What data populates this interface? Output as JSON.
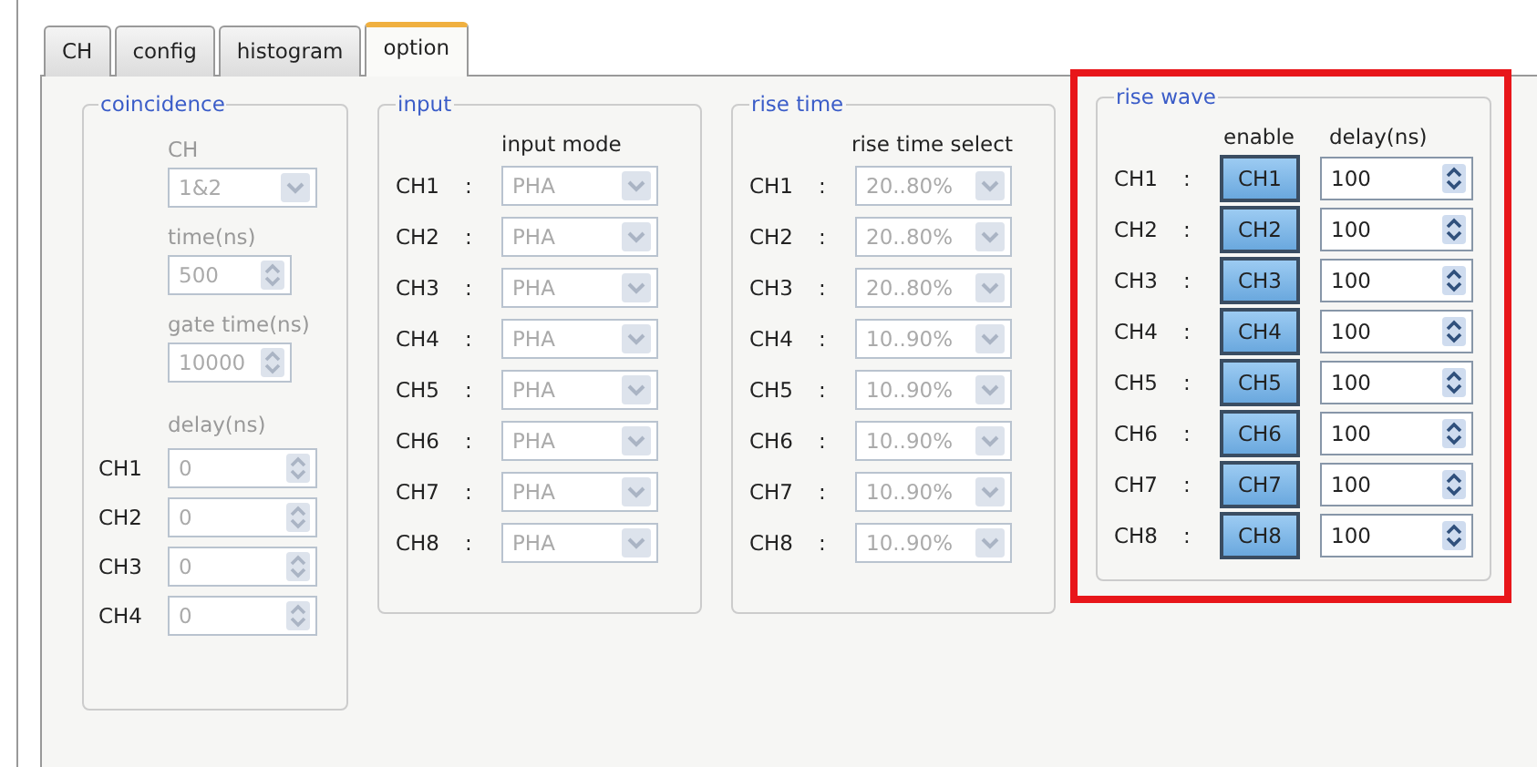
{
  "tabs": [
    {
      "label": "CH",
      "selected": false
    },
    {
      "label": "config",
      "selected": false
    },
    {
      "label": "histogram",
      "selected": false
    },
    {
      "label": "option",
      "selected": true
    }
  ],
  "coincidence": {
    "title": "coincidence",
    "disabled": true,
    "ch_label": "CH",
    "ch_value": "1&2",
    "time_label": "time(ns)",
    "time_value": "500",
    "gate_label": "gate time(ns)",
    "gate_value": "10000",
    "delay_label": "delay(ns)",
    "delays": [
      {
        "channel": "CH1",
        "value": "0"
      },
      {
        "channel": "CH2",
        "value": "0"
      },
      {
        "channel": "CH3",
        "value": "0"
      },
      {
        "channel": "CH4",
        "value": "0"
      }
    ]
  },
  "input": {
    "title": "input",
    "disabled": true,
    "column_header": "input mode",
    "rows": [
      {
        "channel": "CH1",
        "separator": ":",
        "value": "PHA"
      },
      {
        "channel": "CH2",
        "separator": ":",
        "value": "PHA"
      },
      {
        "channel": "CH3",
        "separator": ":",
        "value": "PHA"
      },
      {
        "channel": "CH4",
        "separator": ":",
        "value": "PHA"
      },
      {
        "channel": "CH5",
        "separator": ":",
        "value": "PHA"
      },
      {
        "channel": "CH6",
        "separator": ":",
        "value": "PHA"
      },
      {
        "channel": "CH7",
        "separator": ":",
        "value": "PHA"
      },
      {
        "channel": "CH8",
        "separator": ":",
        "value": "PHA"
      }
    ]
  },
  "rise_time": {
    "title": "rise time",
    "disabled": true,
    "column_header": "rise time select",
    "rows": [
      {
        "channel": "CH1",
        "separator": ":",
        "value": "20..80%"
      },
      {
        "channel": "CH2",
        "separator": ":",
        "value": "20..80%"
      },
      {
        "channel": "CH3",
        "separator": ":",
        "value": "20..80%"
      },
      {
        "channel": "CH4",
        "separator": ":",
        "value": "10..90%"
      },
      {
        "channel": "CH5",
        "separator": ":",
        "value": "10..90%"
      },
      {
        "channel": "CH6",
        "separator": ":",
        "value": "10..90%"
      },
      {
        "channel": "CH7",
        "separator": ":",
        "value": "10..90%"
      },
      {
        "channel": "CH8",
        "separator": ":",
        "value": "10..90%"
      }
    ]
  },
  "rise_wave": {
    "title": "rise wave",
    "disabled": false,
    "highlighted": true,
    "enable_header": "enable",
    "delay_header": "delay(ns)",
    "rows": [
      {
        "channel": "CH1",
        "separator": ":",
        "enable_label": "CH1",
        "enabled": true,
        "delay": "100"
      },
      {
        "channel": "CH2",
        "separator": ":",
        "enable_label": "CH2",
        "enabled": true,
        "delay": "100"
      },
      {
        "channel": "CH3",
        "separator": ":",
        "enable_label": "CH3",
        "enabled": true,
        "delay": "100"
      },
      {
        "channel": "CH4",
        "separator": ":",
        "enable_label": "CH4",
        "enabled": true,
        "delay": "100"
      },
      {
        "channel": "CH5",
        "separator": ":",
        "enable_label": "CH5",
        "enabled": true,
        "delay": "100"
      },
      {
        "channel": "CH6",
        "separator": ":",
        "enable_label": "CH6",
        "enabled": true,
        "delay": "100"
      },
      {
        "channel": "CH7",
        "separator": ":",
        "enable_label": "CH7",
        "enabled": true,
        "delay": "100"
      },
      {
        "channel": "CH8",
        "separator": ":",
        "enable_label": "CH8",
        "enabled": true,
        "delay": "100"
      }
    ]
  }
}
